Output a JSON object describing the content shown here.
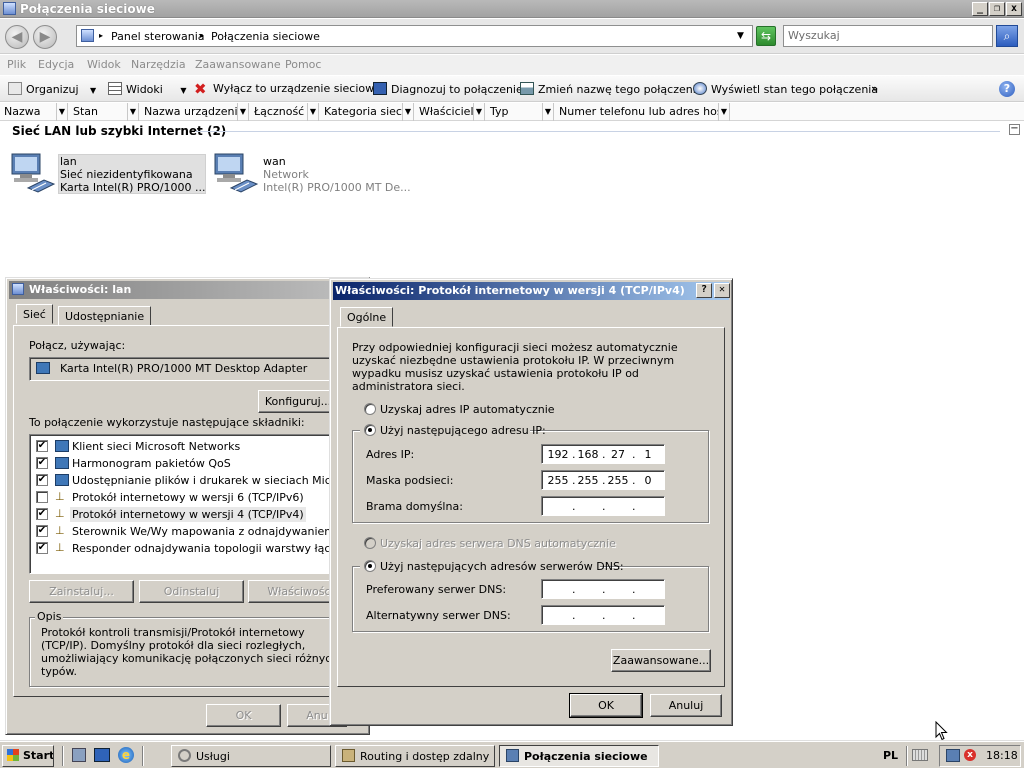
{
  "window": {
    "title": "Połączenia sieciowe",
    "address_path": [
      "Panel sterowania",
      "Połączenia sieciowe"
    ],
    "search_placeholder": "Wyszukaj"
  },
  "menu": [
    "Plik",
    "Edycja",
    "Widok",
    "Narzędzia",
    "Zaawansowane",
    "Pomoc"
  ],
  "toolbar": {
    "organize": "Organizuj",
    "views": "Widoki",
    "disable": "Wyłącz to urządzenie sieciowe",
    "diagnose": "Diagnozuj to połączenie",
    "rename": "Zmień nazwę tego połączenia",
    "status": "Wyświetl stan tego połączenia",
    "more": "»"
  },
  "columns": [
    "Nazwa",
    "Stan",
    "Nazwa urządzenia",
    "Łączność",
    "Kategoria sieci",
    "Właściciel",
    "Typ",
    "Numer telefonu lub adres hosta"
  ],
  "group_title": "Sieć LAN lub szybki Internet (2)",
  "connections": [
    {
      "name": "lan",
      "status": "Sieć niezidentyfikowana",
      "device": "Karta Intel(R) PRO/1000 ..."
    },
    {
      "name": "wan",
      "status": "Network",
      "device": "Intel(R) PRO/1000 MT De..."
    }
  ],
  "lan_props": {
    "title": "Właściwości: lan",
    "tabs": [
      "Sieć",
      "Udostępnianie"
    ],
    "connect_using_label": "Połącz, używając:",
    "adapter": "Karta Intel(R) PRO/1000 MT Desktop Adapter",
    "configure_btn": "Konfiguruj...",
    "components_label": "To połączenie wykorzystuje następujące składniki:",
    "components": [
      {
        "label": "Klient sieci Microsoft Networks",
        "checked": "✔"
      },
      {
        "label": "Harmonogram pakietów QoS",
        "checked": "✔"
      },
      {
        "label": "Udostępnianie plików i drukarek w sieciach Microsoft N",
        "checked": "✔"
      },
      {
        "label": "Protokół internetowy w wersji 6 (TCP/IPv6)",
        "checked": ""
      },
      {
        "label": "Protokół internetowy w wersji 4 (TCP/IPv4)",
        "checked": "✔"
      },
      {
        "label": "Sterownik We/Wy mapowania z odnajdywaniem topolo",
        "checked": "✔"
      },
      {
        "label": "Responder odnajdywania topologii warstwy łącza",
        "checked": "✔"
      }
    ],
    "install_btn": "Zainstaluj...",
    "uninstall_btn": "Odinstaluj",
    "properties_btn": "Właściwości",
    "description_label": "Opis",
    "description": "Protokół kontroli transmisji/Protokół internetowy (TCP/IP). Domyślny protokół dla sieci rozległych, umożliwiający komunikację połączonych sieci różnych typów.",
    "ok_btn": "OK",
    "cancel_btn": "Anu"
  },
  "ipv4": {
    "title": "Właściwości: Protokół internetowy w wersji 4 (TCP/IPv4)",
    "help_btn": "?",
    "close_btn": "✕",
    "tab": "Ogólne",
    "intro": "Przy odpowiedniej konfiguracji sieci możesz automatycznie uzyskać niezbędne ustawienia protokołu IP. W przeciwnym wypadku musisz uzyskać ustawienia protokołu IP od administratora sieci.",
    "auto_ip": "Uzyskaj adres IP automatycznie",
    "manual_ip": "Użyj następującego adresu IP:",
    "ip_label": "Adres IP:",
    "ip": [
      "192",
      "168",
      "27",
      "1"
    ],
    "mask_label": "Maska podsieci:",
    "mask": [
      "255",
      "255",
      "255",
      "0"
    ],
    "gateway_label": "Brama domyślna:",
    "auto_dns": "Uzyskaj adres serwera DNS automatycznie",
    "manual_dns": "Użyj następujących adresów serwerów DNS:",
    "preferred_dns_label": "Preferowany serwer DNS:",
    "alternate_dns_label": "Alternatywny serwer DNS:",
    "advanced_btn": "Zaawansowane...",
    "ok_btn": "OK",
    "cancel_btn": "Anuluj"
  },
  "taskbar": {
    "start": "Start",
    "tasks": [
      "Usługi",
      "Routing i dostęp zdalny",
      "Połączenia sieciowe"
    ],
    "lang": "PL",
    "clock": "18:18"
  }
}
